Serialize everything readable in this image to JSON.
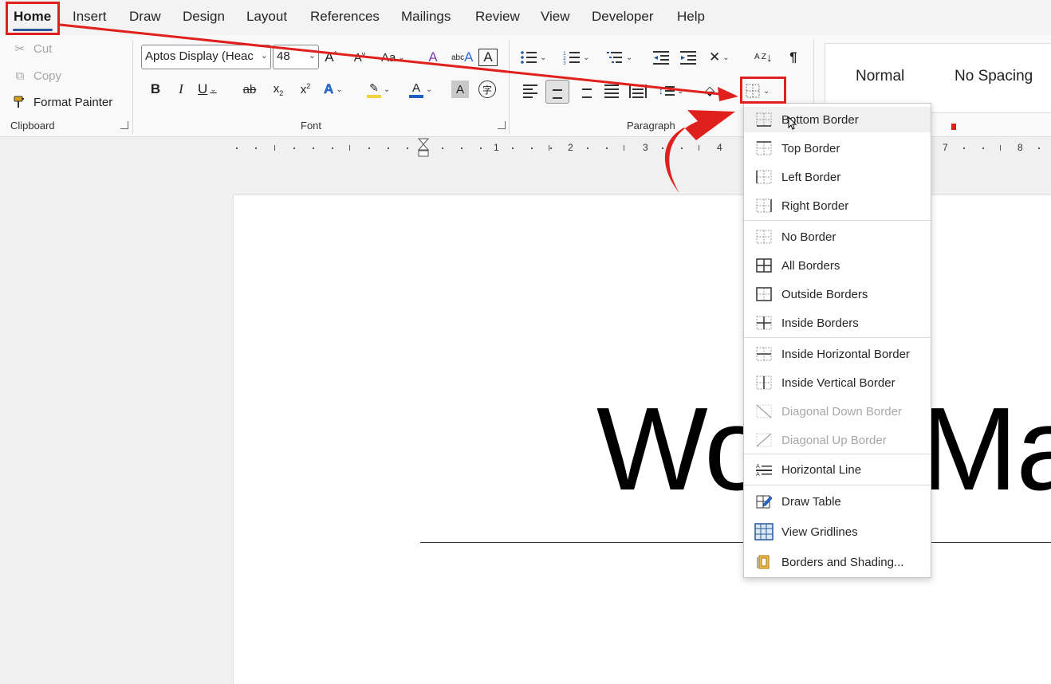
{
  "menu_tabs": [
    "Home",
    "Insert",
    "Draw",
    "Design",
    "Layout",
    "References",
    "Mailings",
    "Review",
    "View",
    "Developer",
    "Help"
  ],
  "active_tab": "Home",
  "clipboard": {
    "cut": "Cut",
    "copy": "Copy",
    "format_painter": "Format Painter",
    "group_label": "Clipboard"
  },
  "font": {
    "name": "Aptos Display (Heac",
    "size": "48",
    "group_label": "Font",
    "abc_label": "abc",
    "az_label": "A Z"
  },
  "paragraph": {
    "group_label": "Paragraph"
  },
  "styles": [
    "Normal",
    "No Spacing"
  ],
  "ruler_numbers": [
    "1",
    "2",
    "3",
    "4",
    "7",
    "8"
  ],
  "document": {
    "heading_text": "Wo",
    "heading_text_2": "Ma"
  },
  "borders_menu": {
    "items": [
      {
        "label": "Bottom Border",
        "icon": "bottom-border-icon",
        "enabled": true
      },
      {
        "label": "Top Border",
        "icon": "top-border-icon",
        "enabled": true
      },
      {
        "label": "Left Border",
        "icon": "left-border-icon",
        "enabled": true
      },
      {
        "label": "Right Border",
        "icon": "right-border-icon",
        "enabled": true
      },
      {
        "label": "No Border",
        "icon": "no-border-icon",
        "enabled": true
      },
      {
        "label": "All Borders",
        "icon": "all-borders-icon",
        "enabled": true
      },
      {
        "label": "Outside Borders",
        "icon": "outside-borders-icon",
        "enabled": true
      },
      {
        "label": "Inside Borders",
        "icon": "inside-borders-icon",
        "enabled": true
      },
      {
        "label": "Inside Horizontal Border",
        "icon": "inside-horizontal-border-icon",
        "enabled": true
      },
      {
        "label": "Inside Vertical Border",
        "icon": "inside-vertical-border-icon",
        "enabled": true
      },
      {
        "label": "Diagonal Down Border",
        "icon": "diagonal-down-border-icon",
        "enabled": false
      },
      {
        "label": "Diagonal Up Border",
        "icon": "diagonal-up-border-icon",
        "enabled": false
      },
      {
        "label": "Horizontal Line",
        "icon": "horizontal-line-icon",
        "enabled": true
      },
      {
        "label": "Draw Table",
        "icon": "draw-table-icon",
        "enabled": true
      },
      {
        "label": "View Gridlines",
        "icon": "view-gridlines-icon",
        "enabled": true
      },
      {
        "label": "Borders and Shading...",
        "icon": "borders-shading-icon",
        "enabled": true
      }
    ]
  },
  "colors": {
    "accent": "#2b579a",
    "annotation_red": "#e0201c",
    "font_color_bar": "#1f5fbf",
    "highlight_bar": "#f4d13d"
  }
}
